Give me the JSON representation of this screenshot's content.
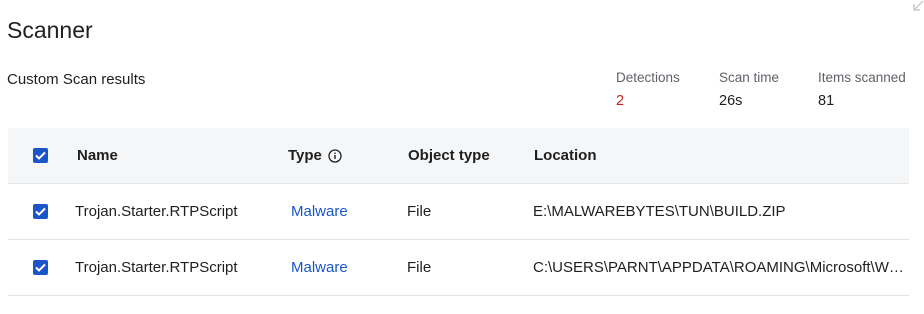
{
  "header": {
    "title": "Scanner",
    "subtitle": "Custom Scan results"
  },
  "stats": {
    "detections_label": "Detections",
    "detections_value": "2",
    "scan_time_label": "Scan time",
    "scan_time_value": "26s",
    "items_scanned_label": "Items scanned",
    "items_scanned_value": "81"
  },
  "table": {
    "columns": {
      "name": "Name",
      "type": "Type",
      "object_type": "Object type",
      "location": "Location"
    },
    "rows": [
      {
        "name": "Trojan.Starter.RTPScript",
        "type": "Malware",
        "object_type": "File",
        "location": "E:\\MALWAREBYTES\\TUN\\BUILD.ZIP",
        "checked": true
      },
      {
        "name": "Trojan.Starter.RTPScript",
        "type": "Malware",
        "object_type": "File",
        "location": "C:\\USERS\\PARNT\\APPDATA\\ROAMING\\Microsoft\\Windows\\Start Menu",
        "checked": true
      }
    ]
  },
  "colors": {
    "accent": "#1a56c8",
    "alert": "#c5221f",
    "header_bg": "#f5f6f7"
  },
  "icons": {
    "header_checkbox": "checkbox-checked-icon",
    "type_info": "info-icon",
    "collapse": "collapse-arrow-icon"
  }
}
